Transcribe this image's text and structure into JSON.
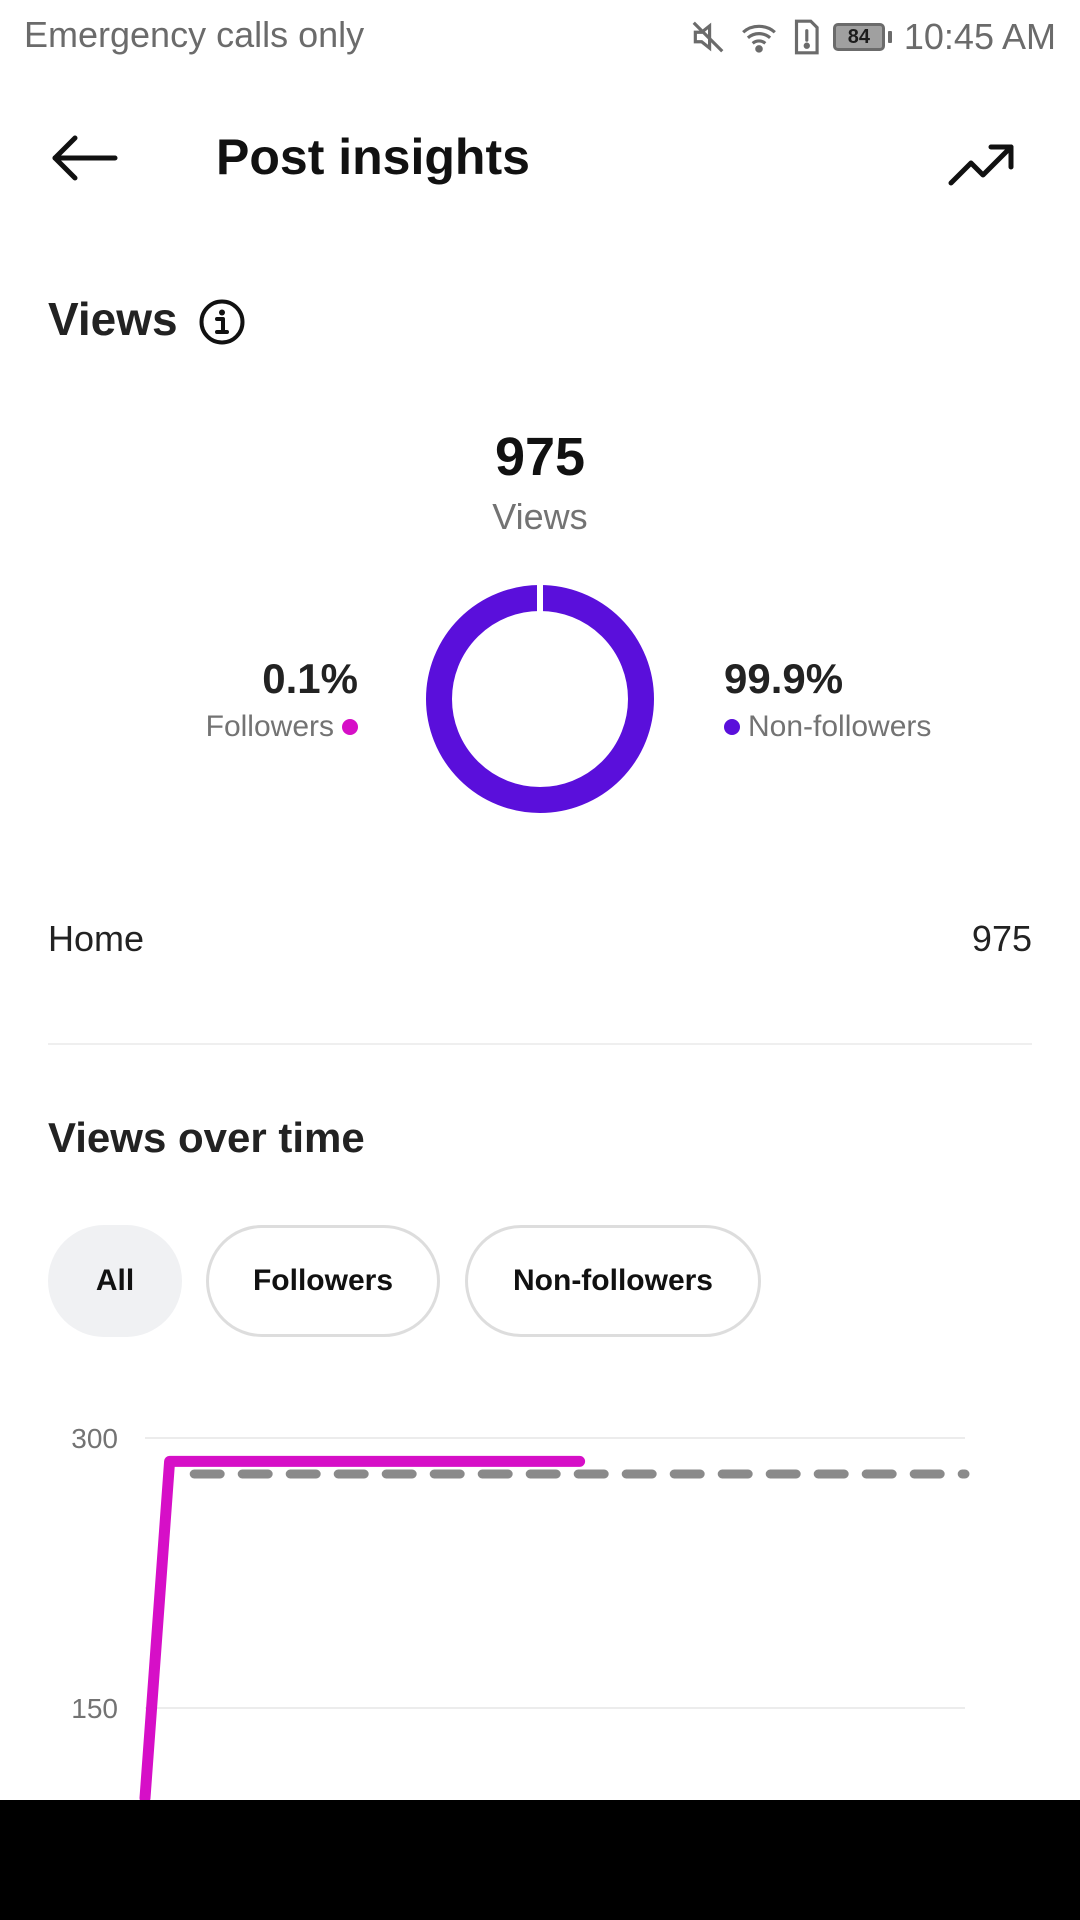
{
  "status_bar": {
    "carrier": "Emergency calls only",
    "battery_level": "84",
    "time": "10:45 AM",
    "icons": [
      "mute-icon",
      "wifi-icon",
      "sim-alert-icon",
      "battery-icon"
    ]
  },
  "header": {
    "title": "Post insights",
    "back_icon": "arrow-left-icon",
    "trend_icon": "trending-up-icon"
  },
  "views": {
    "heading": "Views",
    "total": "975",
    "total_label": "Views",
    "followers_pct": "0.1%",
    "followers_label": "Followers",
    "non_followers_pct": "99.9%",
    "non_followers_label": "Non-followers",
    "colors": {
      "followers": "#d60fc7",
      "non_followers": "#5a0fdb"
    }
  },
  "sources": [
    {
      "label": "Home",
      "value": "975"
    }
  ],
  "views_over_time": {
    "heading": "Views over time",
    "filters": [
      "All",
      "Followers",
      "Non-followers"
    ],
    "selected_filter": "All"
  },
  "chart_data": {
    "type": "line",
    "y_ticks": [
      "300",
      "150"
    ],
    "ylim": [
      0,
      300
    ],
    "grid": true,
    "series": [
      {
        "color": "#d60fc7",
        "style": "solid",
        "x": [
          0,
          0.03,
          0.53
        ],
        "values": [
          100,
          287,
          287
        ]
      },
      {
        "color": "#8a8a8a",
        "style": "dashed",
        "x": [
          0.06,
          1.0
        ],
        "values": [
          280,
          280
        ]
      }
    ]
  }
}
